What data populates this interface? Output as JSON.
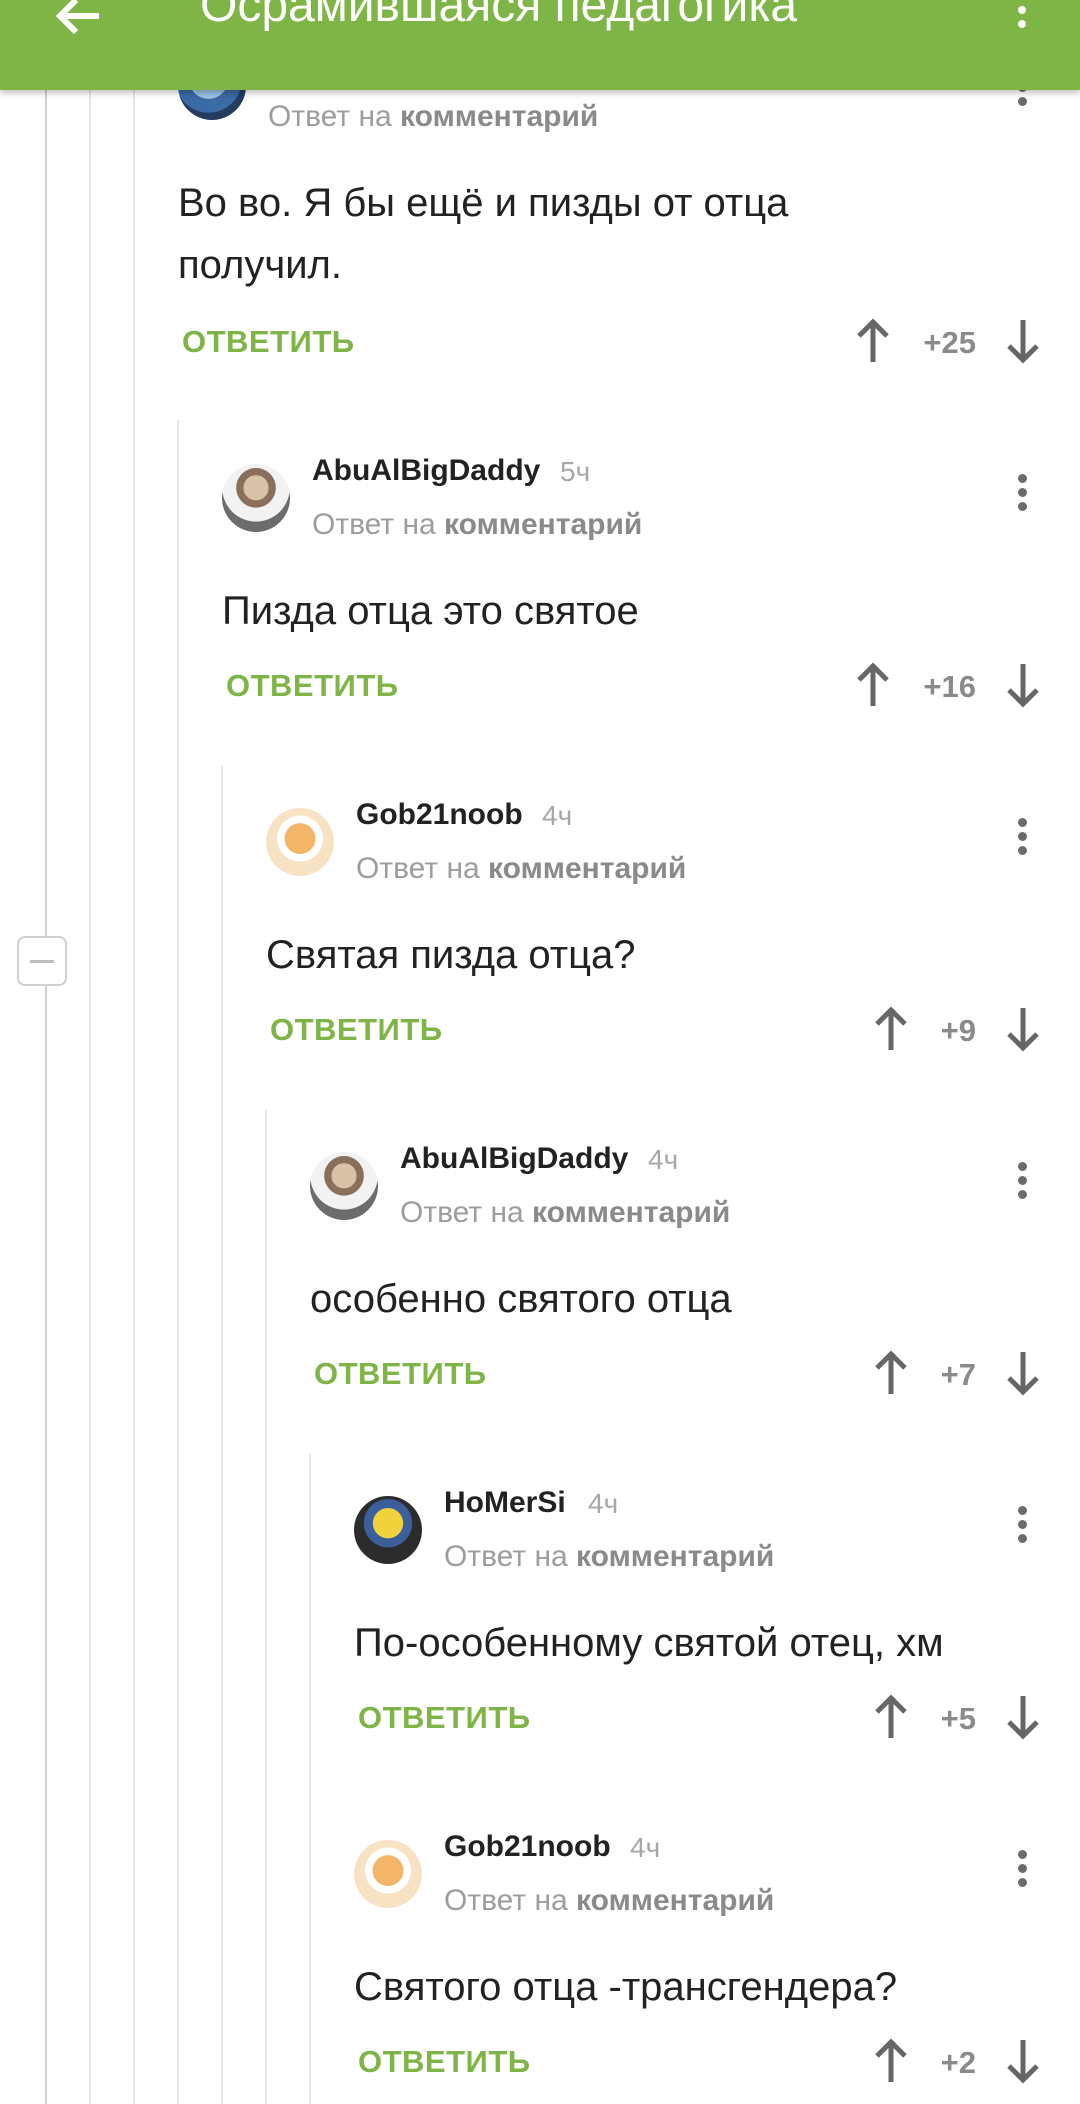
{
  "header": {
    "title": "Осрамившаяся педагогика",
    "back_icon": "arrow-left-icon",
    "menu_icon": "more-vertical-icon"
  },
  "colors": {
    "accent": "#7fb446",
    "line": "#e6e6e6"
  },
  "reply_prefix": "Ответ на",
  "reply_target": "комментарий",
  "reply_action": "ОТВЕТИТЬ",
  "comments": [
    {
      "author": "",
      "time": "",
      "text_line1": "Во во. Я бы ещё и пизды от отца",
      "text_line2": "получил.",
      "score": "+25",
      "avatar": "globe-avatar"
    },
    {
      "author": "AbuAlBigDaddy",
      "time": "5ч",
      "text_line1": "Пизда отца это святое",
      "score": "+16",
      "avatar": "old-man-avatar"
    },
    {
      "author": "Gob21noob",
      "time": "4ч",
      "text_line1": "Святая пизда отца?",
      "score": "+9",
      "avatar": "cake-avatar"
    },
    {
      "author": "AbuAlBigDaddy",
      "time": "4ч",
      "text_line1": "особенно святого отца",
      "score": "+7",
      "avatar": "old-man-avatar"
    },
    {
      "author": "HoMerSi",
      "time": "4ч",
      "text_line1": "По-особенному святой отец, хм",
      "score": "+5",
      "avatar": "homer-avatar"
    },
    {
      "author": "Gob21noob",
      "time": "4ч",
      "text_line1": "Святого отца -трансгендера?",
      "score": "+2",
      "avatar": "cake-avatar"
    }
  ]
}
